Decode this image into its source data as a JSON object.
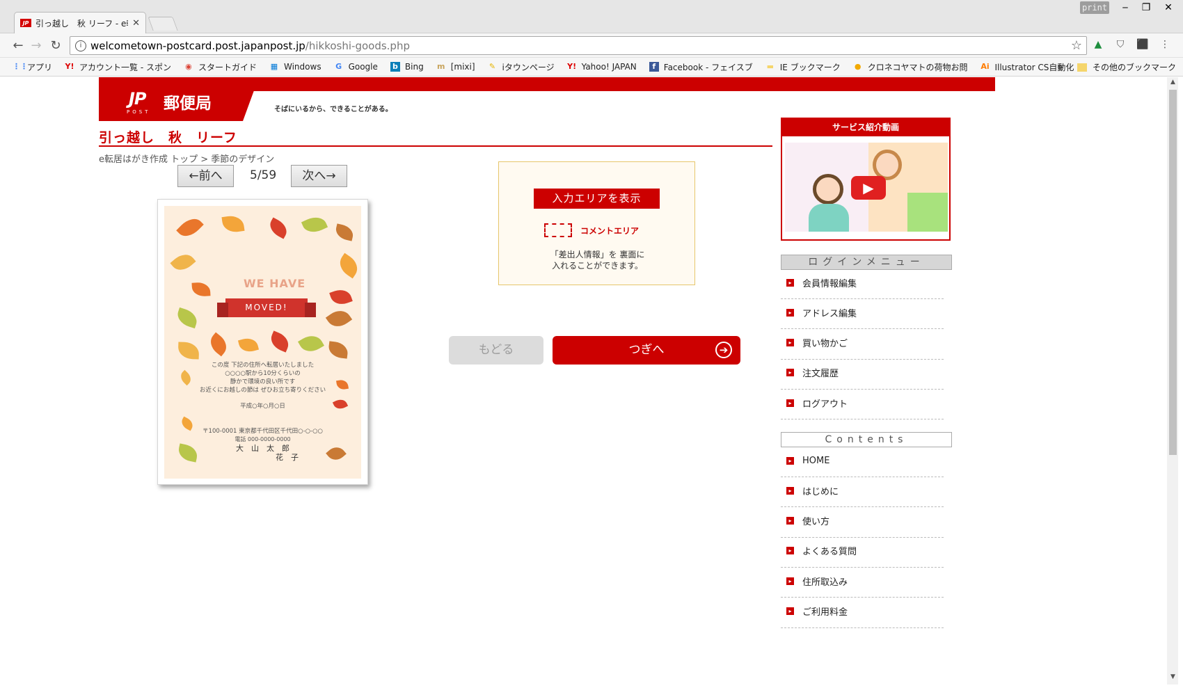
{
  "browser": {
    "tab_title": "引っ越し　秋 リーフ - e転",
    "tab_favicon": "JP",
    "print_label": "print",
    "url_host": "welcometown-postcard.post.japanpost.jp",
    "url_path": "/hikkoshi-goods.php",
    "bookmarks": [
      {
        "label": "アプリ",
        "icon": "apps-icon"
      },
      {
        "label": "アカウント一覧 - スポン",
        "icon": "yahoo-icon"
      },
      {
        "label": "スタートガイド",
        "icon": "chrome-icon"
      },
      {
        "label": "Windows",
        "icon": "windows-icon"
      },
      {
        "label": "Google",
        "icon": "google-icon"
      },
      {
        "label": "Bing",
        "icon": "bing-icon"
      },
      {
        "label": "[mixi]",
        "icon": "mixi-icon"
      },
      {
        "label": "iタウンページ",
        "icon": "itown-icon"
      },
      {
        "label": "Yahoo! JAPAN",
        "icon": "yahoo-icon"
      },
      {
        "label": "Facebook - フェイスブ",
        "icon": "facebook-icon"
      },
      {
        "label": "IE ブックマーク",
        "icon": "folder-icon"
      },
      {
        "label": "クロネコヤマトの荷物お問",
        "icon": "yamato-icon"
      },
      {
        "label": "Illustrator CS自動化",
        "icon": "illustrator-icon"
      }
    ],
    "overflow_label": "»",
    "other_bookmarks": "その他のブックマーク"
  },
  "site": {
    "logo_jp": "JP",
    "logo_post": "POST",
    "logo_name": "郵便局",
    "slogan": "そばにいるから、できることがある。",
    "page_title": "引っ越し　秋　リーフ",
    "breadcrumb": "e転居はがき作成 トップ > 季節のデザイン",
    "prev_label": "←前へ",
    "next_label": "次へ→",
    "page_counter": "5/59"
  },
  "card": {
    "we_have": "WE HAVE",
    "moved": "MOVED!",
    "message_lines": [
      "この度 下記の住所へ転居いたしました",
      "○○○○駅から10分くらいの",
      "静かで環境の良い所です",
      "お近くにお越しの節は ぜひお立ち寄りください"
    ],
    "date": "平成○年○月○日",
    "address": "〒100-0001 東京都千代田区千代田○-○-○○",
    "phone": "電話 000-0000-0000",
    "names_line1": "大　山　太　郎",
    "names_line2": "花　子"
  },
  "input_area": {
    "show_button": "入力エリアを表示",
    "comment_label": "コメントエリア",
    "note_line1": "「差出人情報」を 裏面に",
    "note_line2": "入れることができます。"
  },
  "actions": {
    "back_label": "もどる",
    "next_label": "つぎへ",
    "next_arrow": "➔"
  },
  "sidebar": {
    "video_title": "サービス紹介動画",
    "login_title": "ログインメニュー",
    "login_items": [
      "会員情報編集",
      "アドレス編集",
      "買い物かご",
      "注文履歴",
      "ログアウト"
    ],
    "contents_title": "Contents",
    "contents_items": [
      "HOME",
      "はじめに",
      "使い方",
      "よくある質問",
      "住所取込み",
      "ご利用料金"
    ]
  },
  "colors": {
    "brand_red": "#cc0000"
  }
}
